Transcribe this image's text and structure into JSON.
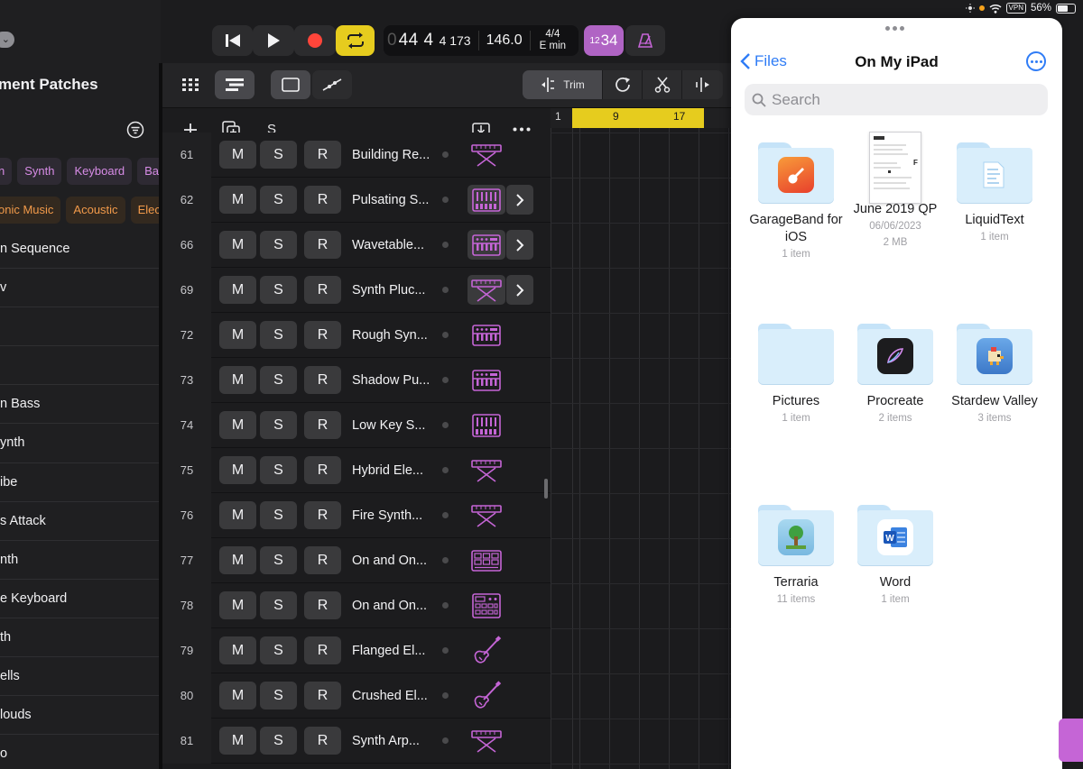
{
  "status_bar": {
    "vpn": "VPN",
    "battery": "56%"
  },
  "patches": {
    "title": "ment Patches",
    "tags_row1": [
      "n",
      "Synth",
      "Keyboard",
      "Bass"
    ],
    "tags_row2": [
      "onic Music",
      "Acoustic",
      "Electr"
    ],
    "items": [
      "n Sequence",
      "v",
      "",
      "",
      "n Bass",
      "ynth",
      "ibe",
      "s Attack",
      "nth",
      "e Keyboard",
      "th",
      "ells",
      "louds",
      "o"
    ]
  },
  "transport": {
    "position_prefix": "0",
    "position": "44 4",
    "ticks": "4 173",
    "tempo": "146.0",
    "time_signature": "4/4",
    "key": "E min",
    "count_in_small": "12",
    "count_in_large": "34"
  },
  "toolbar": {
    "trim_label": "Trim"
  },
  "track_header": {
    "solo_label": "S"
  },
  "ruler": {
    "marks": [
      "1",
      "9",
      "17"
    ]
  },
  "tracks": [
    {
      "num": "61",
      "m": "M",
      "s": "S",
      "r": "R",
      "name": "Building Re...",
      "instrument": "keyboard-stand-icon",
      "boxed": false,
      "chevron": false
    },
    {
      "num": "62",
      "m": "M",
      "s": "S",
      "r": "R",
      "name": "Pulsating S...",
      "instrument": "synth-module-icon",
      "boxed": true,
      "chevron": true
    },
    {
      "num": "66",
      "m": "M",
      "s": "S",
      "r": "R",
      "name": "Wavetable...",
      "instrument": "synth-keyboard-icon",
      "boxed": true,
      "chevron": true
    },
    {
      "num": "69",
      "m": "M",
      "s": "S",
      "r": "R",
      "name": "Synth Pluc...",
      "instrument": "keyboard-stand-icon",
      "boxed": true,
      "chevron": true
    },
    {
      "num": "72",
      "m": "M",
      "s": "S",
      "r": "R",
      "name": "Rough Syn...",
      "instrument": "synth-keyboard-icon",
      "boxed": false,
      "chevron": false
    },
    {
      "num": "73",
      "m": "M",
      "s": "S",
      "r": "R",
      "name": "Shadow Pu...",
      "instrument": "synth-keyboard-icon",
      "boxed": false,
      "chevron": false
    },
    {
      "num": "74",
      "m": "M",
      "s": "S",
      "r": "R",
      "name": "Low Key S...",
      "instrument": "synth-module-icon",
      "boxed": false,
      "chevron": false
    },
    {
      "num": "75",
      "m": "M",
      "s": "S",
      "r": "R",
      "name": "Hybrid Ele...",
      "instrument": "keyboard-stand-icon",
      "boxed": false,
      "chevron": false
    },
    {
      "num": "76",
      "m": "M",
      "s": "S",
      "r": "R",
      "name": "Fire Synth...",
      "instrument": "keyboard-stand-icon",
      "boxed": false,
      "chevron": false
    },
    {
      "num": "77",
      "m": "M",
      "s": "S",
      "r": "R",
      "name": "On and On...",
      "instrument": "drum-pad-icon",
      "boxed": false,
      "chevron": false
    },
    {
      "num": "78",
      "m": "M",
      "s": "S",
      "r": "R",
      "name": "On and On...",
      "instrument": "drum-machine-icon",
      "boxed": false,
      "chevron": false
    },
    {
      "num": "79",
      "m": "M",
      "s": "S",
      "r": "R",
      "name": "Flanged El...",
      "instrument": "electric-guitar-icon",
      "boxed": false,
      "chevron": false
    },
    {
      "num": "80",
      "m": "M",
      "s": "S",
      "r": "R",
      "name": "Crushed El...",
      "instrument": "electric-guitar-icon",
      "boxed": false,
      "chevron": false
    },
    {
      "num": "81",
      "m": "M",
      "s": "S",
      "r": "R",
      "name": "Synth Arp...",
      "instrument": "keyboard-stand-icon",
      "boxed": false,
      "chevron": false
    }
  ],
  "files": {
    "back_label": "Files",
    "title": "On My iPad",
    "search_placeholder": "Search",
    "items": [
      {
        "name": "GarageBand for iOS",
        "meta1": "1 item",
        "meta2": "",
        "kind": "folder",
        "badge": "garageband-icon"
      },
      {
        "name": "June 2019 QP",
        "meta1": "06/06/2023",
        "meta2": "2 MB",
        "kind": "document",
        "badge": "pdf-document-icon"
      },
      {
        "name": "LiquidText",
        "meta1": "1 item",
        "meta2": "",
        "kind": "folder",
        "badge": "liquidtext-icon"
      },
      {
        "name": "Pictures",
        "meta1": "1 item",
        "meta2": "",
        "kind": "folder",
        "badge": ""
      },
      {
        "name": "Procreate",
        "meta1": "2 items",
        "meta2": "",
        "kind": "folder",
        "badge": "procreate-icon"
      },
      {
        "name": "Stardew Valley",
        "meta1": "3 items",
        "meta2": "",
        "kind": "folder",
        "badge": "stardew-valley-icon"
      },
      {
        "name": "Terraria",
        "meta1": "11 items",
        "meta2": "",
        "kind": "folder",
        "badge": "terraria-icon"
      },
      {
        "name": "Word",
        "meta1": "1 item",
        "meta2": "",
        "kind": "folder",
        "badge": "word-icon"
      }
    ]
  },
  "colors": {
    "accent_yellow": "#e6cc1e",
    "record_red": "#ff453a",
    "instrument_pink": "#c565d6",
    "files_blue": "#2f7cf6"
  }
}
